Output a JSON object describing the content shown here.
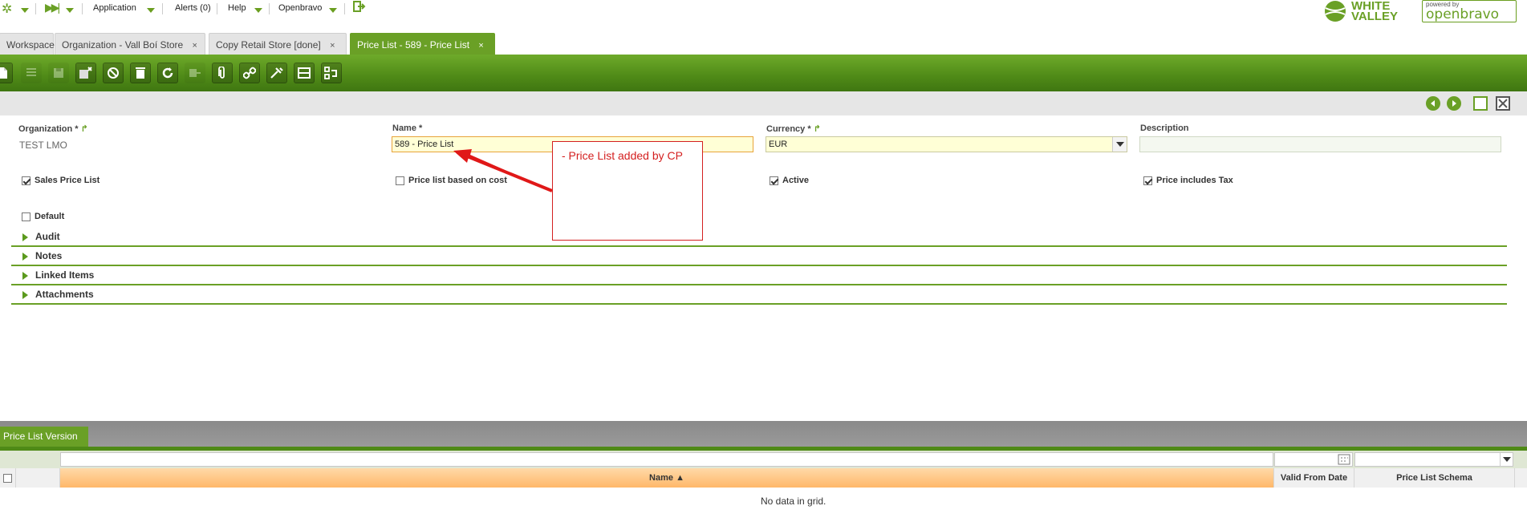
{
  "menu": {
    "application": "Application",
    "alerts": "Alerts (0)",
    "help": "Help",
    "user": "Openbravo"
  },
  "brand": {
    "wv_line1": "WHITE",
    "wv_line2": "VALLEY",
    "ob_powered": "powered by",
    "ob_name": "openbravo"
  },
  "tabs": [
    {
      "label": "Workspace",
      "closable": false
    },
    {
      "label": "Organization - Vall Boí Store",
      "closable": true
    },
    {
      "label": "Copy Retail Store [done]",
      "closable": true
    },
    {
      "label": "Price List - 589 - Price List",
      "closable": true,
      "active": true
    }
  ],
  "tab_close_glyph": "×",
  "form": {
    "organization_label": "Organization *",
    "organization_value": "TEST LMO",
    "name_label": "Name *",
    "name_value": "589 - Price List",
    "currency_label": "Currency *",
    "currency_value": "EUR",
    "description_label": "Description",
    "description_value": "",
    "sales_price_list": "Sales Price List",
    "price_list_based_on_cost": "Price list based on cost",
    "active": "Active",
    "price_includes_tax": "Price includes Tax",
    "default": "Default"
  },
  "sections": [
    "Audit",
    "Notes",
    "Linked Items",
    "Attachments"
  ],
  "annotation": "- Price List added by CP",
  "grid": {
    "tab_label": "Price List Version",
    "col_name": "Name ▲",
    "col_valid_from": "Valid From Date",
    "col_schema": "Price List Schema",
    "empty": "No data in grid."
  },
  "colors": {
    "accent": "#6aa026",
    "annotation": "#d42020",
    "sorted_header": "#ffb869"
  }
}
